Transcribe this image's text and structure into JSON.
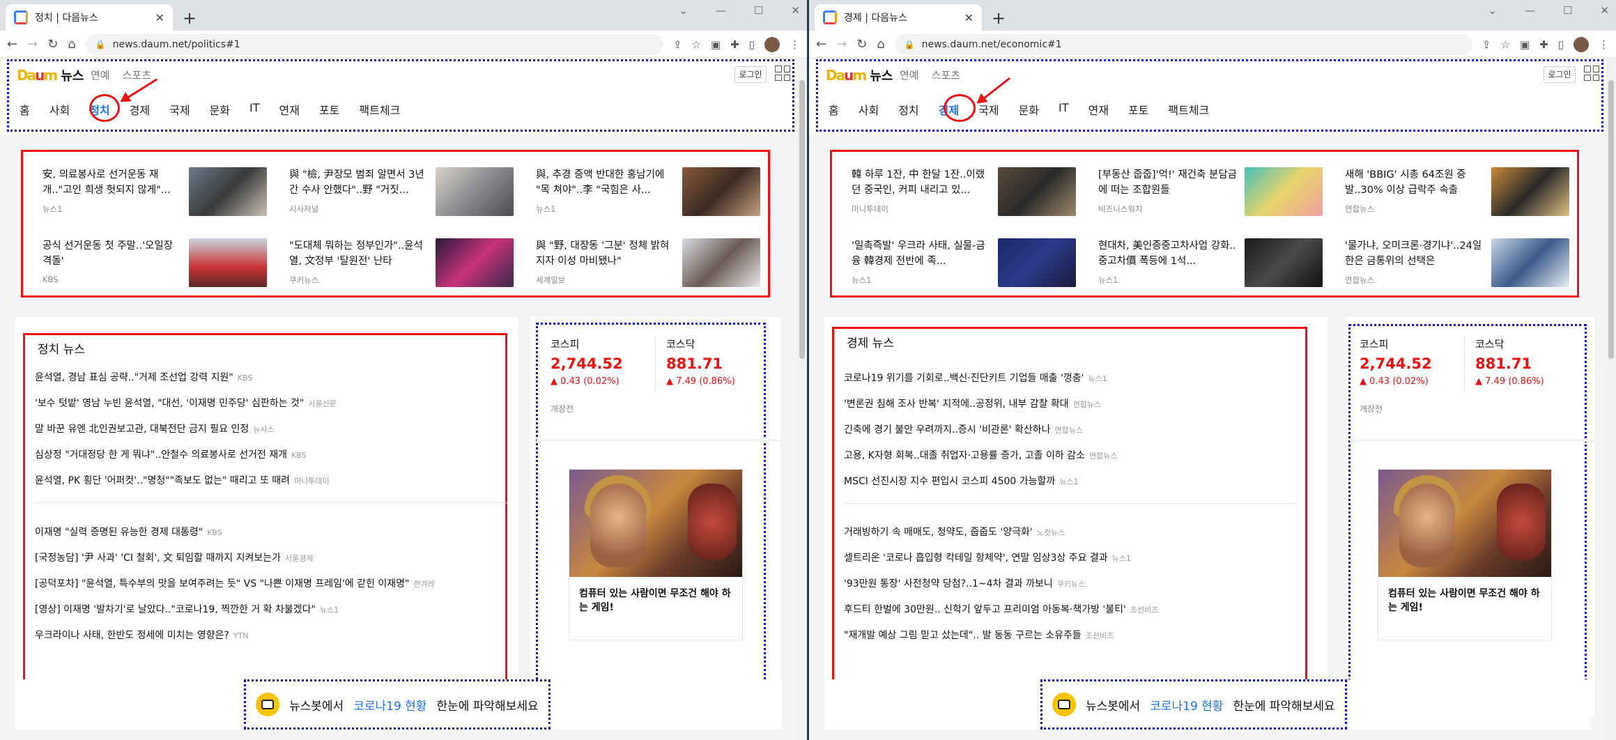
{
  "left": {
    "tab_title": "정치 | 다음뉴스",
    "url": "news.daum.net/politics#1",
    "logo": "Daum",
    "logo_news": "뉴스",
    "sub": [
      "연예",
      "스포츠"
    ],
    "login": "로그인",
    "menu": [
      "홈",
      "사회",
      "정치",
      "경제",
      "국제",
      "문화",
      "IT",
      "연재",
      "포토",
      "팩트체크"
    ],
    "active": 2,
    "headlines": [
      {
        "title": "安, 의료봉사로 선거운동 재개..\"고인 희생 헛되지 않게\"...",
        "source": "뉴스1"
      },
      {
        "title": "與 \"檢, 尹장모 범죄 알면서 3년간 수사 안했다\"..野 \"거짓...",
        "source": "시사저널"
      },
      {
        "title": "與, 추경 증액 반대한 홍남기에 \"목 쳐야\"..李 \"국힘은 사...",
        "source": "뉴스1"
      },
      {
        "title": "공식 선거운동 첫 주말..'오일장 격돌'",
        "source": "KBS"
      },
      {
        "title": "\"도대체 뭐하는 정부인가\"..윤석열, 文정부 '탈원전' 난타",
        "source": "쿠키뉴스"
      },
      {
        "title": "與 \"野, 대장동 '그분' 정체 밝혀지자 이성 마비됐나\"",
        "source": "세계일보"
      }
    ],
    "section_title": "정치 뉴스",
    "news": [
      {
        "t": "윤석열, 경남 표심 공략..\"거제 조선업 강력 지원\"",
        "s": "KBS"
      },
      {
        "t": "'보수 텃밭' 영남 누빈 윤석열, \"대선, '이재명 민주당' 심판하는 것\"",
        "s": "서울신문"
      },
      {
        "t": "말 바꾼 유엔 北인권보고관, 대북전단 금지 필요 인정",
        "s": "뉴시스"
      },
      {
        "t": "심상정 \"거대정당 한 게 뭐냐\"..안철수 의료봉사로 선거전 재개",
        "s": "KBS"
      },
      {
        "t": "윤석열, PK 횡단 '어퍼컷'..\"명청\"\"족보도 없는\" 때리고 또 때려",
        "s": "머니투데이"
      },
      {
        "t": "이재명 \"실력 증명된 유능한 경제 대통령\"",
        "s": "KBS"
      },
      {
        "t": "[국정농담] '尹 사과' 'CI 철회', 文 퇴임할 때까지 지켜보는가",
        "s": "서울경제"
      },
      {
        "t": "[공덕포차] \"윤석열, 특수부의 맛을 보여주려는 듯\" VS \"나쁜 이재명 프레임'에 갇힌 이재명\"",
        "s": "한겨레"
      },
      {
        "t": "[영상] 이재명 '발차기'로 날았다..\"코로나19, 찍깐한 거 확 차불겠다\"",
        "s": "뉴스1"
      },
      {
        "t": "우크라이나 사태, 한반도 정세에 미치는 영향은?",
        "s": "YTN"
      }
    ]
  },
  "right": {
    "tab_title": "경제 | 다음뉴스",
    "url": "news.daum.net/economic#1",
    "logo": "Daum",
    "logo_news": "뉴스",
    "sub": [
      "연예",
      "스포츠"
    ],
    "login": "로그인",
    "menu": [
      "홈",
      "사회",
      "정치",
      "경제",
      "국제",
      "문화",
      "IT",
      "연재",
      "포토",
      "팩트체크"
    ],
    "active": 3,
    "headlines": [
      {
        "title": "韓 하루 1잔, 中 한달 1잔..이랬던 중국인, 커피 내리고 있...",
        "source": "머니투데이"
      },
      {
        "title": "[부동산 줍줍]'억!' 재건축 분담금에 떠는 조합원들",
        "source": "비즈니스워치"
      },
      {
        "title": "새해 'BBIG' 시총 64조원 증발..30% 이상 급락주 속출",
        "source": "연합뉴스"
      },
      {
        "title": "'일촉즉발' 우크라 사태, 실물-금융 韓경제 전반에 족...",
        "source": "뉴스1"
      },
      {
        "title": "현대차, 美인증중고차사업 강화..중고차價 폭등에 1석...",
        "source": "뉴스1"
      },
      {
        "title": "'물가냐, 오미크론·경기냐'..24일 한은 금통위의 선택은",
        "source": "연합뉴스"
      }
    ],
    "section_title": "경제 뉴스",
    "news": [
      {
        "t": "코로나19 위기를 기회로..백신·진단키트 기업들 매출 '껑충'",
        "s": "뉴스1"
      },
      {
        "t": "'변론권 침해 조사 반복' 지적에..공정위, 내부 감찰 확대",
        "s": "연합뉴스"
      },
      {
        "t": "긴축에 경기 불안 우려까지..증시 '비관론' 확산하나",
        "s": "연합뉴스"
      },
      {
        "t": "고용, K자형 회복..대졸 취업자·고용률 증가, 고졸 이하 감소",
        "s": "연합뉴스"
      },
      {
        "t": "MSCI 선진시장 지수 편입시 코스피 4500 가능할까",
        "s": "뉴스1"
      },
      {
        "t": "거래빙하기 속 매매도, 청약도, 줍줍도 '양극화'",
        "s": "노컷뉴스"
      },
      {
        "t": "셀트리온 '코로나 흡입형 칵테일 항체약', 연말 임상3상 주요 결과",
        "s": "뉴스1"
      },
      {
        "t": "'93만원 통장' 사전청약 당첨?..1~4차 결과 까보니",
        "s": "쿠키뉴스"
      },
      {
        "t": "후드티 한벌에 30만원.. 신학기 앞두고 프리미엄 아동복·책가방 '불티'",
        "s": "조선비즈"
      },
      {
        "t": "\"재개발 예상 그림 믿고 샀는데\".. 발 동동 구르는 소유주들",
        "s": "조선비즈"
      }
    ]
  },
  "market": {
    "kospi_label": "코스피",
    "kospi": "2,744.52",
    "kospi_chg": "▲ 0.43 (0.02%)",
    "kosdaq_label": "코스닥",
    "kosdaq": "881.71",
    "kosdaq_chg": "▲ 7.49 (0.86%)",
    "status": "개장전"
  },
  "ad": {
    "text": "컴퓨터 있는 사람이면 무조건 해야 하는 게임!"
  },
  "newsbot": {
    "pre": "뉴스봇에서",
    "highlight": "코로나19 현황",
    "post": "한눈에 파악해보세요"
  },
  "colors": {
    "accent": "#1a73e8",
    "annotation_red": "#e11111",
    "annotation_blue": "#1515c9",
    "stock_up": "#e11111"
  }
}
